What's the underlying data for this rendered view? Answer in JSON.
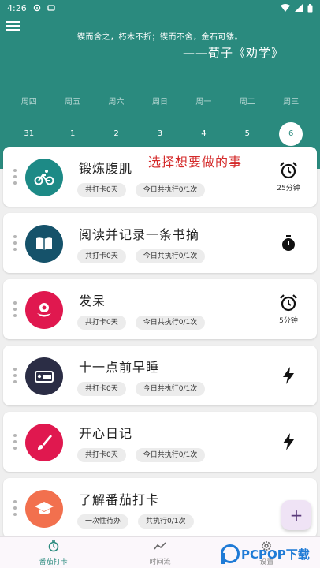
{
  "status": {
    "time": "4:26"
  },
  "header": {
    "quote": "锲而舍之，朽木不折；锲而不舍，金石可镂。",
    "source": "——荀子《劝学》"
  },
  "week": {
    "days": [
      "周四",
      "周五",
      "周六",
      "周日",
      "周一",
      "周二",
      "周三"
    ],
    "dates": [
      "31",
      "1",
      "2",
      "3",
      "4",
      "5",
      "6"
    ],
    "selected_index": 6
  },
  "annotation": "选择想要做的事",
  "habits": [
    {
      "title": "锻炼腹肌",
      "chips": [
        "共打卡0天",
        "今日共执行0/1次"
      ],
      "icon": "bike-icon",
      "color": "#1d8a86",
      "right_icon": "alarm-clock-icon",
      "right_text": "25分钟"
    },
    {
      "title": "阅读并记录一条书摘",
      "chips": [
        "共打卡0天",
        "今日共执行0/1次"
      ],
      "icon": "book-icon",
      "color": "#15526a",
      "right_icon": "stopwatch-icon",
      "right_text": ""
    },
    {
      "title": "发呆",
      "chips": [
        "共打卡0天",
        "今日共执行0/1次"
      ],
      "icon": "flower-icon",
      "color": "#e0184f",
      "right_icon": "alarm-clock-icon",
      "right_text": "5分钟"
    },
    {
      "title": "十一点前早睡",
      "chips": [
        "共打卡0天",
        "今日共执行0/1次"
      ],
      "icon": "bed-icon",
      "color": "#2b2d45",
      "right_icon": "lightning-icon",
      "right_text": ""
    },
    {
      "title": "开心日记",
      "chips": [
        "共打卡0天",
        "今日共执行0/1次"
      ],
      "icon": "brush-icon",
      "color": "#e0184f",
      "right_icon": "lightning-icon",
      "right_text": ""
    },
    {
      "title": "了解番茄打卡",
      "chips": [
        "一次性待办",
        "共执行0/1次"
      ],
      "icon": "graduation-cap-icon",
      "color": "#f2704e",
      "right_icon": "",
      "right_text": ""
    }
  ],
  "fab": {
    "label": "+"
  },
  "nav": [
    {
      "label": "番茄打卡",
      "icon": "timer-icon",
      "active": true
    },
    {
      "label": "时间流",
      "icon": "trend-icon",
      "active": false
    },
    {
      "label": "设置",
      "icon": "gear-icon",
      "active": false
    }
  ],
  "watermark": "PCPOP下载",
  "colors": {
    "primary": "#2a8a7e",
    "annotation": "#d42a2a"
  }
}
